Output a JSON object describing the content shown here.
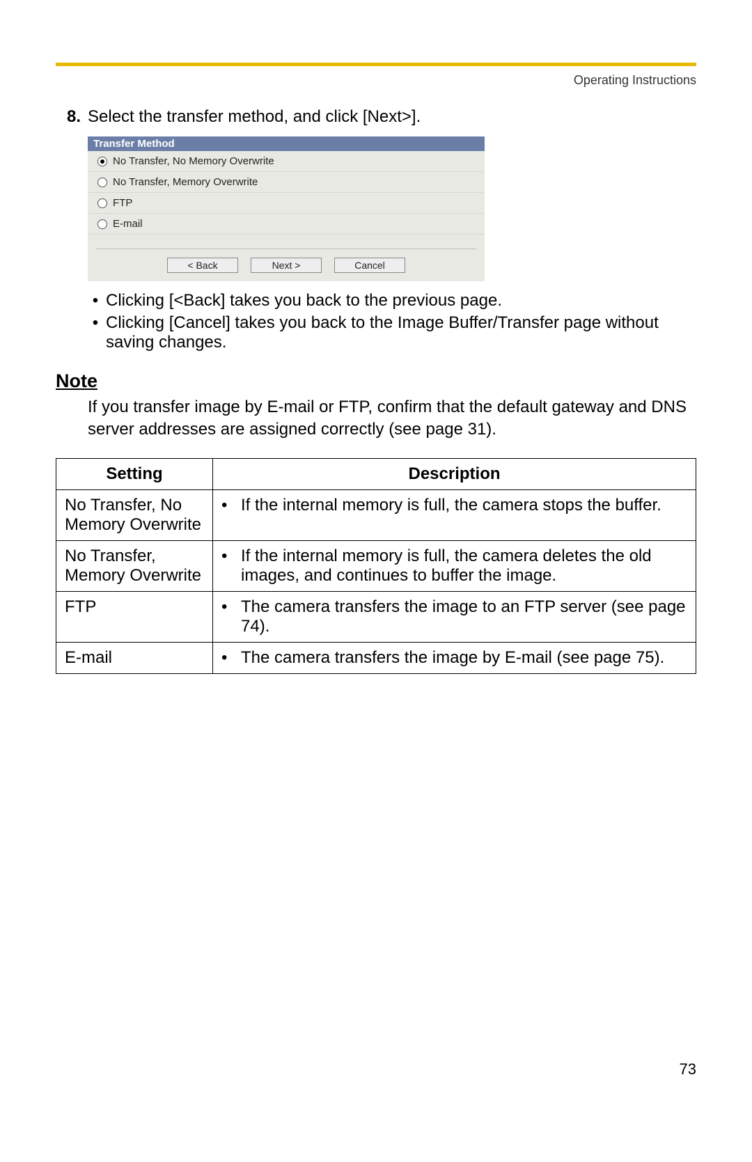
{
  "header": {
    "right": "Operating Instructions"
  },
  "step": {
    "number": "8.",
    "text": "Select the transfer method, and click [Next>]."
  },
  "dialog": {
    "title": "Transfer Method",
    "options": [
      {
        "label": "No Transfer, No Memory Overwrite",
        "selected": true
      },
      {
        "label": "No Transfer, Memory Overwrite",
        "selected": false
      },
      {
        "label": "FTP",
        "selected": false
      },
      {
        "label": "E-mail",
        "selected": false
      }
    ],
    "buttons": {
      "back": "< Back",
      "next": "Next >",
      "cancel": "Cancel"
    }
  },
  "bullets": [
    "Clicking [<Back] takes you back to the previous page.",
    "Clicking [Cancel] takes you back to the Image Buffer/Transfer page without saving changes."
  ],
  "note": {
    "heading": "Note",
    "body": "If you transfer image by E-mail or FTP, confirm that the default gateway and DNS server addresses are assigned correctly (see page 31)."
  },
  "table": {
    "head": {
      "c1": "Setting",
      "c2": "Description"
    },
    "rows": [
      {
        "setting": "No Transfer, No Memory Overwrite",
        "desc": "If the internal memory is full, the camera stops the buffer."
      },
      {
        "setting": "No Transfer, Memory Overwrite",
        "desc": "If the internal memory is full, the camera deletes the old images, and continues to buffer the image."
      },
      {
        "setting": "FTP",
        "desc": "The camera transfers the image to an FTP server (see page 74)."
      },
      {
        "setting": "E-mail",
        "desc": "The camera transfers the image by E-mail (see page 75)."
      }
    ]
  },
  "pageNumber": "73"
}
